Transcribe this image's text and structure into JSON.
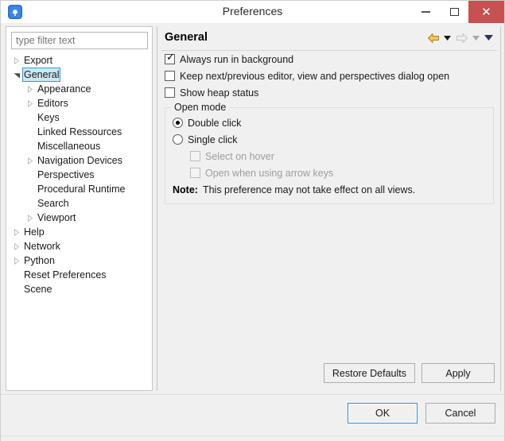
{
  "window": {
    "title": "Preferences",
    "app_icon": "app-icon",
    "buttons": {
      "minimize": "minimize-icon",
      "maximize": "maximize-icon",
      "close": "✕"
    }
  },
  "filter": {
    "placeholder": "type filter text",
    "value": ""
  },
  "tree": {
    "items": [
      {
        "label": "Export",
        "depth": 0,
        "state": "collapsed",
        "selected": false
      },
      {
        "label": "General",
        "depth": 0,
        "state": "expanded",
        "selected": true
      },
      {
        "label": "Appearance",
        "depth": 1,
        "state": "collapsed",
        "selected": false
      },
      {
        "label": "Editors",
        "depth": 1,
        "state": "collapsed",
        "selected": false
      },
      {
        "label": "Keys",
        "depth": 1,
        "state": "leaf",
        "selected": false
      },
      {
        "label": "Linked Ressources",
        "depth": 1,
        "state": "leaf",
        "selected": false
      },
      {
        "label": "Miscellaneous",
        "depth": 1,
        "state": "leaf",
        "selected": false
      },
      {
        "label": "Navigation Devices",
        "depth": 1,
        "state": "collapsed",
        "selected": false
      },
      {
        "label": "Perspectives",
        "depth": 1,
        "state": "leaf",
        "selected": false
      },
      {
        "label": "Procedural Runtime",
        "depth": 1,
        "state": "leaf",
        "selected": false
      },
      {
        "label": "Search",
        "depth": 1,
        "state": "leaf",
        "selected": false
      },
      {
        "label": "Viewport",
        "depth": 1,
        "state": "collapsed",
        "selected": false
      },
      {
        "label": "Help",
        "depth": 0,
        "state": "collapsed",
        "selected": false
      },
      {
        "label": "Network",
        "depth": 0,
        "state": "collapsed",
        "selected": false
      },
      {
        "label": "Python",
        "depth": 0,
        "state": "collapsed",
        "selected": false
      },
      {
        "label": "Reset Preferences",
        "depth": 0,
        "state": "leaf",
        "selected": false
      },
      {
        "label": "Scene",
        "depth": 0,
        "state": "leaf",
        "selected": false
      }
    ]
  },
  "panel": {
    "title": "General",
    "nav": {
      "back_icon": "back-arrow-icon",
      "back_menu_icon": "chevron-down-icon",
      "forward_icon": "forward-arrow-icon",
      "forward_menu_icon": "chevron-down-icon",
      "menu_icon": "chevron-down-icon",
      "back_enabled": true,
      "forward_enabled": false
    },
    "checkboxes": [
      {
        "label": "Always run in background",
        "checked": true,
        "enabled": true
      },
      {
        "label": "Keep next/previous editor, view and perspectives dialog open",
        "checked": false,
        "enabled": true
      },
      {
        "label": "Show heap status",
        "checked": false,
        "enabled": true
      }
    ],
    "open_mode": {
      "legend": "Open mode",
      "radios": [
        {
          "label": "Double click",
          "selected": true
        },
        {
          "label": "Single click",
          "selected": false
        }
      ],
      "sub_checkboxes": [
        {
          "label": "Select on hover",
          "checked": false,
          "enabled": false
        },
        {
          "label": "Open when using arrow keys",
          "checked": false,
          "enabled": false
        }
      ],
      "note_label": "Note:",
      "note_text": "This preference may not take effect on all views."
    },
    "buttons": {
      "restore_defaults": "Restore Defaults",
      "apply": "Apply"
    }
  },
  "footer": {
    "ok": "OK",
    "cancel": "Cancel"
  },
  "colors": {
    "close_button": "#c75050",
    "selection": "#cbe8f6",
    "selection_border": "#26a0da",
    "panel_bg": "#f0f0f0",
    "tree_bg": "#ffffff",
    "back_arrow": "#e8b23a",
    "forward_arrow": "#d8d8d8",
    "menu_chevron": "#3a3a6e"
  }
}
